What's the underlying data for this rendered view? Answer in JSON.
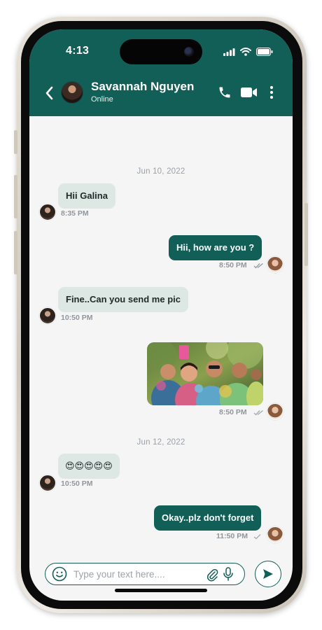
{
  "status_bar": {
    "time": "4:13"
  },
  "header": {
    "contact_name": "Savannah Nguyen",
    "contact_status": "Online",
    "icons": [
      "back-icon",
      "phone-icon",
      "video-icon",
      "more-icon"
    ]
  },
  "dates": [
    "Jun 10, 2022",
    "Jun 12, 2022"
  ],
  "messages": [
    {
      "dir": "in",
      "text": "Hii Galina",
      "time": "8:35 PM"
    },
    {
      "dir": "out",
      "text": "Hii, how are you ?",
      "time": "8:50 PM",
      "status": "read"
    },
    {
      "dir": "in",
      "text": "Fine..Can you send me pic",
      "time": "10:50 PM"
    },
    {
      "dir": "out",
      "type": "image",
      "time": "8:50 PM",
      "status": "delivered"
    },
    {
      "dir": "in",
      "text": "😍😍😍😍😍",
      "time": "10:50 PM"
    },
    {
      "dir": "out",
      "text": "Okay..plz don't forget",
      "time": "11:50 PM",
      "status": "sent"
    }
  ],
  "composer": {
    "placeholder": "Type your text here....",
    "icons": [
      "emoji-icon",
      "attach-icon",
      "mic-icon",
      "send-icon"
    ]
  },
  "colors": {
    "brand": "#125f57",
    "incoming_bubble": "#dde8e5",
    "background": "#f5f5f6"
  }
}
